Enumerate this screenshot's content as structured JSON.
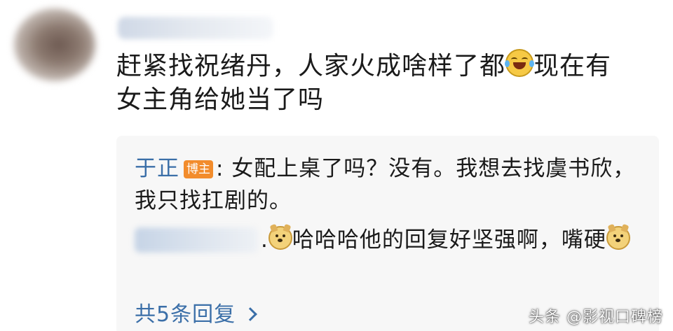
{
  "comment": {
    "line1_before_emoji": "赶紧找祝绪丹，人家火成啥样了都",
    "emoji": "laugh-cry-icon",
    "line1_after_emoji": "现在有",
    "line2": "女主角给她当了吗"
  },
  "reply1": {
    "author": "于正",
    "badge": "博主",
    "text": ": 女配上桌了吗？没有。我想去找虞书欣，我只找扛剧的。"
  },
  "reply2": {
    "separator": ".",
    "emoji": "doge-icon",
    "text": "哈哈哈他的回复好坚强啊，嘴硬",
    "trailing_emoji": "doge-icon"
  },
  "more_replies": {
    "label": "共5条回复"
  },
  "watermark": {
    "text": "头条 @影视口碑榜"
  },
  "colors": {
    "link_blue": "#3b6fa8",
    "badge_orange": "#f28c2c",
    "reply_bg": "#f7f7f7"
  }
}
